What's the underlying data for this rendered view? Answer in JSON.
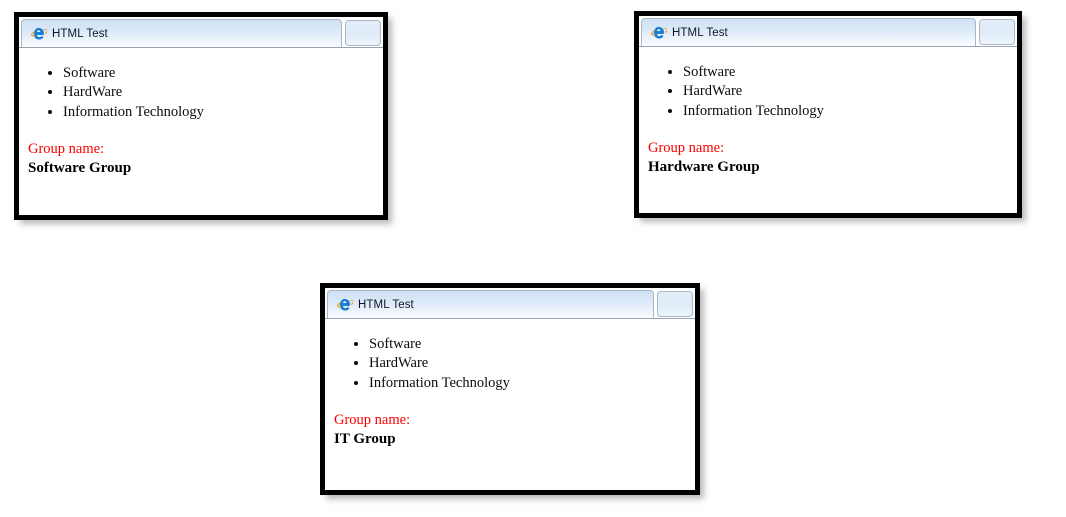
{
  "browser": {
    "app": "Internet Explorer",
    "tab_icon": "internet-explorer-icon",
    "new_tab_label": ""
  },
  "windows": [
    {
      "id": "window-software",
      "tab_title": "HTML Test",
      "list_items": [
        "Software",
        "HardWare",
        "Information Technology"
      ],
      "group_label": "Group name:",
      "group_value": "Software Group"
    },
    {
      "id": "window-hardware",
      "tab_title": "HTML Test",
      "list_items": [
        "Software",
        "HardWare",
        "Information Technology"
      ],
      "group_label": "Group name:",
      "group_value": "Hardware Group"
    },
    {
      "id": "window-it",
      "tab_title": "HTML Test",
      "list_items": [
        "Software",
        "HardWare",
        "Information Technology"
      ],
      "group_label": "Group name:",
      "group_value": "IT Group"
    }
  ],
  "colors": {
    "group_label": "#ff0000",
    "group_value": "#000000",
    "window_border": "#000000",
    "tab_gradient_top": "#cfe1f4",
    "tab_gradient_bottom": "#fafcfe",
    "page_background": "#ffffff"
  }
}
